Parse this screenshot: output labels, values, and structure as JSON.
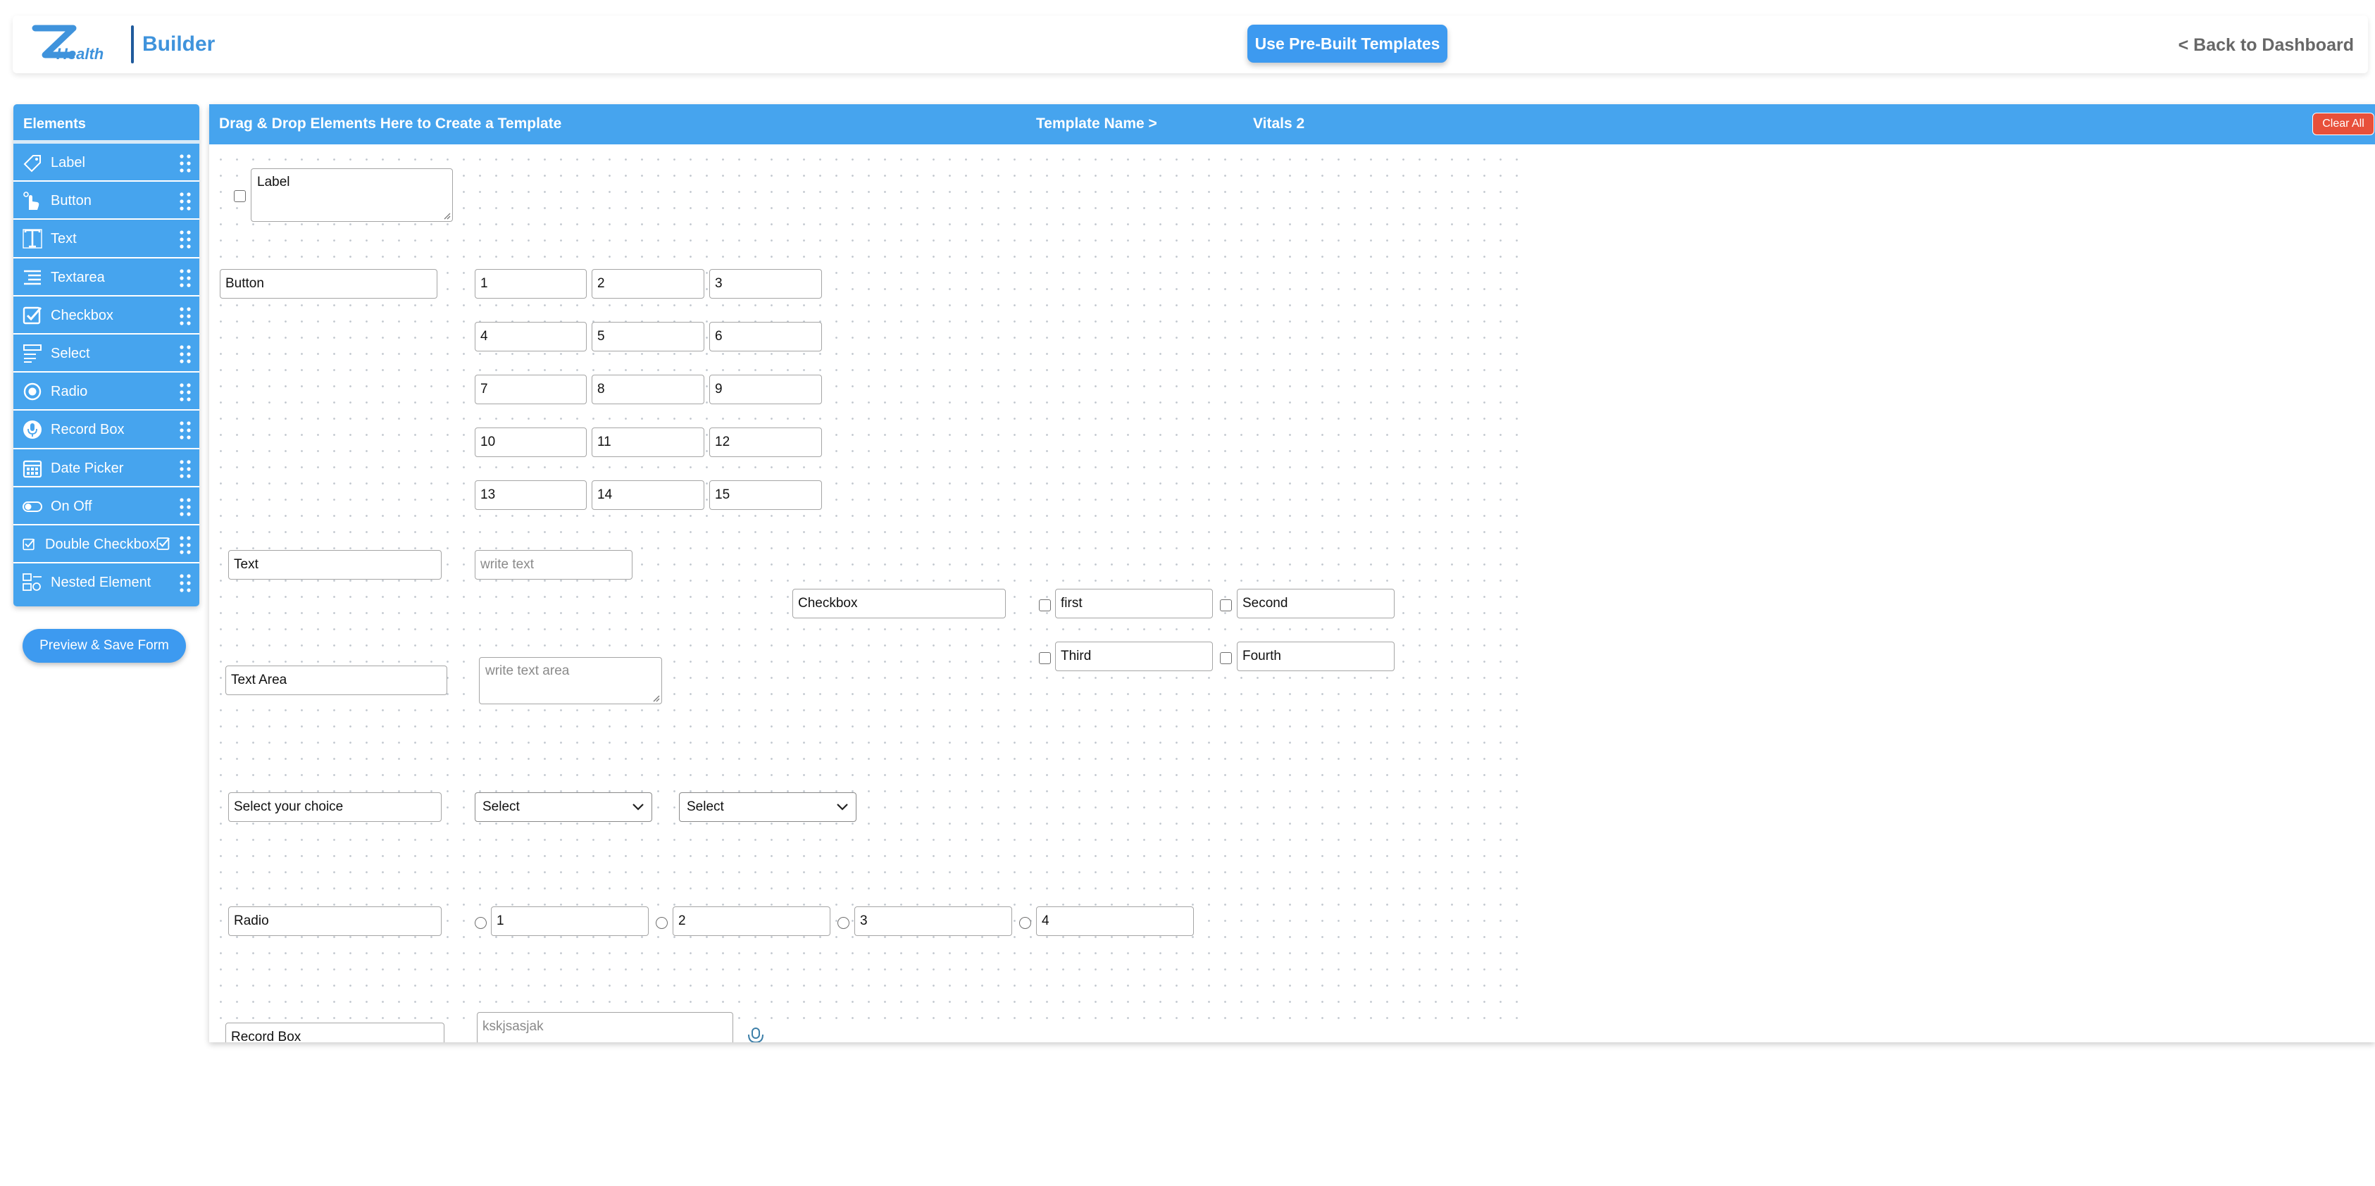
{
  "header": {
    "logo_text": "Health",
    "brand": "Builder",
    "templates_button": "Use Pre-Built Templates",
    "back_link": "< Back to Dashboard"
  },
  "sidebar": {
    "title": "Elements",
    "items": [
      {
        "label": "Label",
        "icon": "tag-icon"
      },
      {
        "label": "Button",
        "icon": "pointer-hand-icon"
      },
      {
        "label": "Text",
        "icon": "text-cursor-icon"
      },
      {
        "label": "Textarea",
        "icon": "align-lines-icon"
      },
      {
        "label": "Checkbox",
        "icon": "checkbox-checked-icon"
      },
      {
        "label": "Select",
        "icon": "select-list-icon"
      },
      {
        "label": "Radio",
        "icon": "radio-icon"
      },
      {
        "label": "Record Box",
        "icon": "microphone-icon"
      },
      {
        "label": "Date Picker",
        "icon": "calendar-icon"
      },
      {
        "label": "On Off",
        "icon": "toggle-icon"
      },
      {
        "label": "Double Checkbox",
        "icon": "double-checkbox-icon"
      },
      {
        "label": "Nested Element",
        "icon": "nested-element-icon"
      }
    ],
    "preview_button": "Preview & Save Form"
  },
  "canvas": {
    "bar_title": "Drag & Drop Elements Here to Create a Template",
    "template_name_label": "Template Name >",
    "template_name_value": "Vitals 2",
    "clear_button": "Clear All",
    "label_block": {
      "value": "Label"
    },
    "button_block": {
      "label": "Button",
      "values": [
        "1",
        "2",
        "3",
        "4",
        "5",
        "6",
        "7",
        "8",
        "9",
        "10",
        "11",
        "12",
        "13",
        "14",
        "15"
      ]
    },
    "text_block": {
      "label": "Text",
      "placeholder": "write text"
    },
    "checkbox_block": {
      "label": "Checkbox",
      "options": [
        "first",
        "Second",
        "Third",
        "Fourth"
      ]
    },
    "textarea_block": {
      "label": "Text Area",
      "placeholder": "write text area"
    },
    "select_block": {
      "label": "Select your choice",
      "selects": [
        "Select",
        "Select"
      ]
    },
    "radio_block": {
      "label": "Radio",
      "options": [
        "1",
        "2",
        "3",
        "4"
      ]
    },
    "record_block": {
      "label": "Record Box",
      "value": "kskjsasjak"
    }
  }
}
